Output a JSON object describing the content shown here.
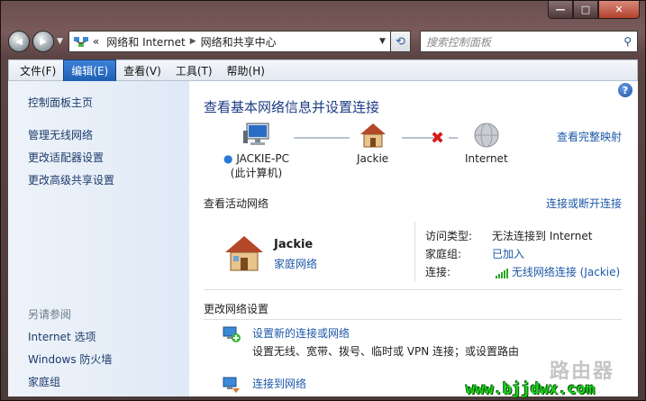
{
  "window": {
    "caption_buttons": {
      "minimize": "—",
      "maximize": "□",
      "close": "✕"
    }
  },
  "nav": {
    "back_glyph": "◀",
    "forward_glyph": "▶",
    "breadcrumb": {
      "root_glyph": "«",
      "part1": "网络和 Internet",
      "separator": "▶",
      "part2": "网络和共享中心"
    },
    "refresh_glyph": "⟲",
    "search_placeholder": "搜索控制面板",
    "search_glyph": "⚲"
  },
  "menu": {
    "items": [
      "文件(F)",
      "编辑(E)",
      "查看(V)",
      "工具(T)",
      "帮助(H)"
    ],
    "active_index": 1
  },
  "sidebar": {
    "home": "控制面板主页",
    "links": [
      "管理无线网络",
      "更改适配器设置",
      "更改高级共享设置"
    ],
    "see_also_heading": "另请参阅",
    "see_also": [
      "Internet 选项",
      "Windows 防火墙",
      "家庭组"
    ]
  },
  "main": {
    "help_glyph": "?",
    "title": "查看基本网络信息并设置连接",
    "full_map_link": "查看完整映射",
    "map": {
      "computer_name": "JACKIE-PC",
      "computer_sub": "(此计算机)",
      "network_name": "Jackie",
      "internet_label": "Internet",
      "broken_glyph": "✖"
    },
    "active_heading": "查看活动网络",
    "connect_link": "连接或断开连接",
    "active_network": {
      "name": "Jackie",
      "type": "家庭网络",
      "access_key": "访问类型:",
      "access_val": "无法连接到 Internet",
      "homegroup_key": "家庭组:",
      "homegroup_val": "已加入",
      "connection_key": "连接:",
      "connection_val": "无线网络连接 (Jackie)"
    },
    "change_heading": "更改网络设置",
    "tasks": [
      {
        "link": "设置新的连接或网络",
        "desc": "设置无线、宽带、拨号、临时或 VPN 连接；或设置路由"
      },
      {
        "link": "连接到网络",
        "desc": ""
      }
    ]
  },
  "watermark": {
    "brand": "路由器",
    "url": "www.bjjdwx.com"
  },
  "colors": {
    "link": "#1c58a8",
    "title": "#1d3b85",
    "menu_active": "#1f5fb6",
    "error_x": "#d71a1a",
    "watermark_green": "#1dd41d"
  }
}
